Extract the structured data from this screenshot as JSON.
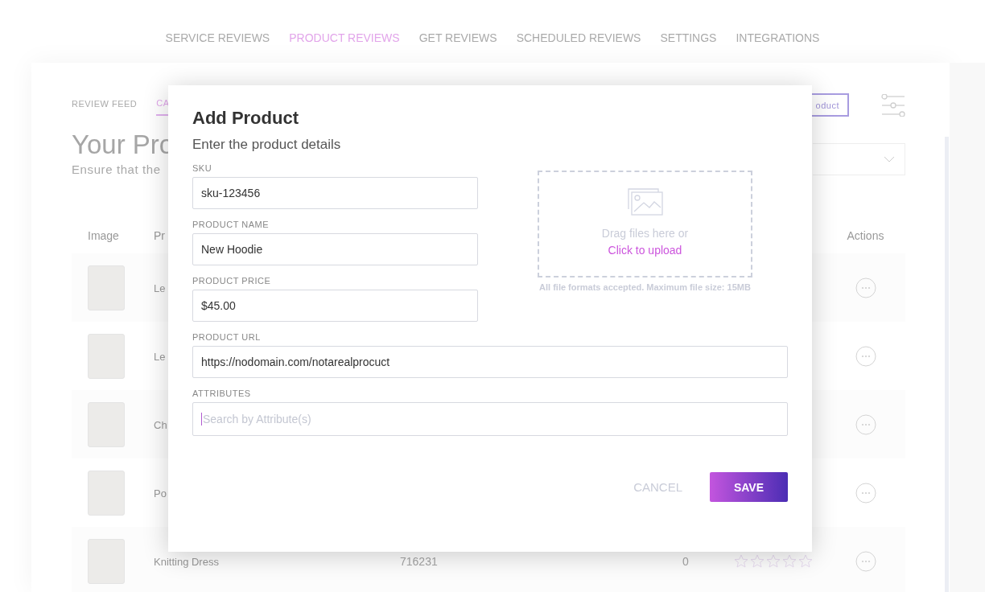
{
  "nav": {
    "tabs": [
      {
        "label": "SERVICE REVIEWS",
        "selected": false
      },
      {
        "label": "PRODUCT REVIEWS",
        "selected": true
      },
      {
        "label": "GET REVIEWS",
        "selected": false
      },
      {
        "label": "SCHEDULED REVIEWS",
        "selected": false
      },
      {
        "label": "SETTINGS",
        "selected": false
      },
      {
        "label": "INTEGRATIONS",
        "selected": false
      }
    ]
  },
  "page": {
    "subtabs": [
      {
        "label": "REVIEW FEED",
        "selected": false
      },
      {
        "label": "CA",
        "selected": true
      }
    ],
    "add_button": "oduct",
    "title": "Your Pro",
    "subtitle": "Ensure that the",
    "table": {
      "columns": [
        "Image",
        "Pr",
        "Actions"
      ],
      "rows": [
        {
          "name": "Le"
        },
        {
          "name": "Le"
        },
        {
          "name": "Ch"
        },
        {
          "name": "Po"
        },
        {
          "name": "Knitting Dress",
          "sku": "716231",
          "count": "0",
          "stars": 0
        }
      ]
    }
  },
  "modal": {
    "title": "Add Product",
    "subtitle": "Enter the product details",
    "left_fields": [
      {
        "label": "SKU",
        "value": "sku-123456",
        "focused": false
      },
      {
        "label": "PRODUCT NAME",
        "value": "New Hoodie",
        "focused": false
      },
      {
        "label": "PRODUCT PRICE",
        "value": "$45.00",
        "focused": false
      }
    ],
    "upload": {
      "text": "Drag files here or",
      "link": "Click to upload",
      "note": "All file formats accepted. Maximum file size: 15MB"
    },
    "fields": [
      {
        "label": "PRODUCT URL",
        "value": "https://nodomain.com/notarealprocuct",
        "focused": false
      },
      {
        "label": "ATTRIBUTES",
        "placeholder": "Search by Attribute(s)",
        "focused": true
      }
    ],
    "buttons": {
      "cancel": "CANCEL",
      "save": "SAVE"
    }
  }
}
